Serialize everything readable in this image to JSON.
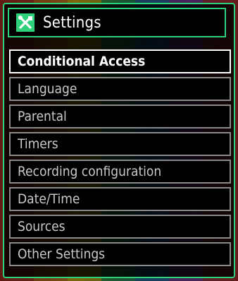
{
  "header": {
    "title": "Settings",
    "icon": "tools-icon",
    "accent_color": "#2fd07a"
  },
  "menu": {
    "selected_index": 0,
    "items": [
      {
        "label": "Conditional Access"
      },
      {
        "label": "Language"
      },
      {
        "label": "Parental"
      },
      {
        "label": "Timers"
      },
      {
        "label": "Recording configuration"
      },
      {
        "label": "Date/Time"
      },
      {
        "label": "Sources"
      },
      {
        "label": "Other Settings"
      }
    ]
  }
}
